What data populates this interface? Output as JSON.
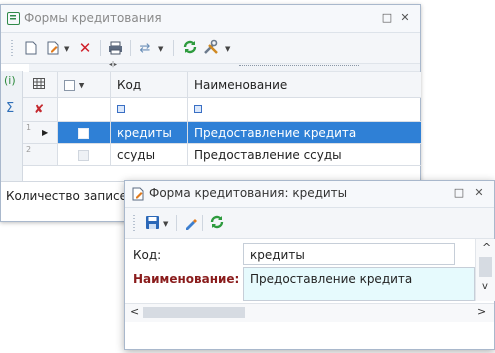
{
  "main_window": {
    "title": "Формы кредитования",
    "controls": {
      "restore": "□",
      "close": "✕"
    },
    "grid": {
      "columns": {
        "code": "Код",
        "name": "Наименование"
      },
      "rows": [
        {
          "num": "1",
          "code": "кредиты",
          "name": "Предоставление кредита",
          "selected": true
        },
        {
          "num": "2",
          "code": "ссуды",
          "name": "Предоставление ссуды",
          "selected": false
        }
      ]
    },
    "side_tabs": {
      "info": "(i)",
      "sum": "Σ"
    },
    "status_label": "Количество записей"
  },
  "detail_window": {
    "title": "Форма кредитования: кредиты",
    "controls": {
      "restore": "□",
      "close": "✕"
    },
    "fields": {
      "code_label": "Код:",
      "code_value": "кредиты",
      "name_label": "Наименование:",
      "name_value": "Предоставление кредита"
    },
    "scroll": {
      "left": "<",
      "right": ">",
      "up": "^",
      "down": "v"
    }
  },
  "colors": {
    "selection": "#2f80d6",
    "required_label": "#8a1c1c",
    "name_field_bg": "#e6fafd",
    "filter_icon": "#3a6fc4"
  },
  "icons": [
    "app-form-icon",
    "new-doc-icon",
    "edit-icon",
    "delete-icon",
    "print-icon",
    "link-icon",
    "refresh-icon",
    "tools-icon",
    "save-icon",
    "pin-icon"
  ]
}
